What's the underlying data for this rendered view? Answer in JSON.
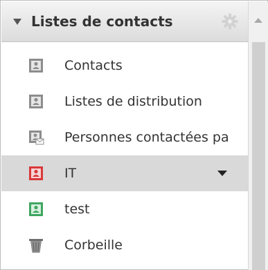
{
  "panel": {
    "title": "Listes de contacts",
    "items": [
      {
        "label": "Contacts",
        "icon": "contact-card-icon",
        "color": "#8c8c8c"
      },
      {
        "label": "Listes de distribution",
        "icon": "contact-card-icon",
        "color": "#8c8c8c"
      },
      {
        "label": "Personnes contactées pa",
        "icon": "contact-card-mail-icon",
        "color": "#8c8c8c"
      },
      {
        "label": "IT",
        "icon": "contact-card-icon",
        "color": "#d9383a",
        "selected": true
      },
      {
        "label": "test",
        "icon": "contact-card-icon",
        "color": "#3fa661"
      },
      {
        "label": "Corbeille",
        "icon": "trash-icon",
        "color": "#6f6f6f"
      }
    ]
  }
}
